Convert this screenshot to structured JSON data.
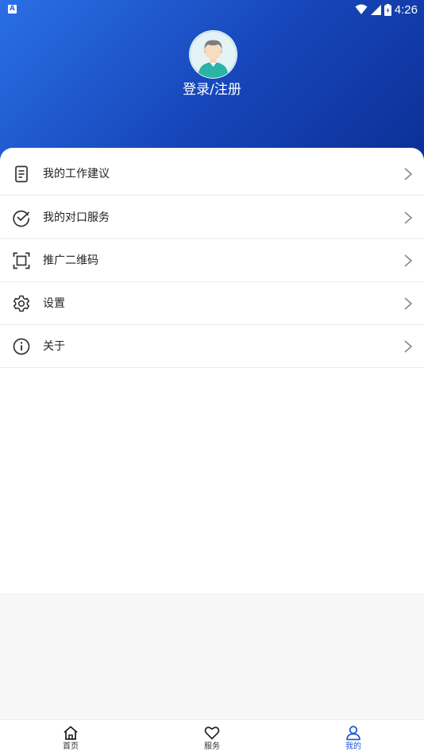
{
  "status_bar": {
    "notification_badge": "A",
    "time": "4:26"
  },
  "profile": {
    "login_label": "登录/注册"
  },
  "menu": [
    {
      "label": "我的工作建议",
      "icon": "document-icon"
    },
    {
      "label": "我的对口服务",
      "icon": "check-circle-icon"
    },
    {
      "label": "推广二维码",
      "icon": "scan-frame-icon"
    },
    {
      "label": "设置",
      "icon": "gear-icon"
    },
    {
      "label": "关于",
      "icon": "info-icon"
    }
  ],
  "bottom_nav": [
    {
      "label": "首页",
      "icon": "home-icon",
      "active": false
    },
    {
      "label": "服务",
      "icon": "heart-icon",
      "active": false
    },
    {
      "label": "我的",
      "icon": "user-icon",
      "active": true
    }
  ],
  "colors": {
    "header_start": "#2a6fe6",
    "header_end": "#0d2f96",
    "active_tab": "#1f5ad6"
  }
}
